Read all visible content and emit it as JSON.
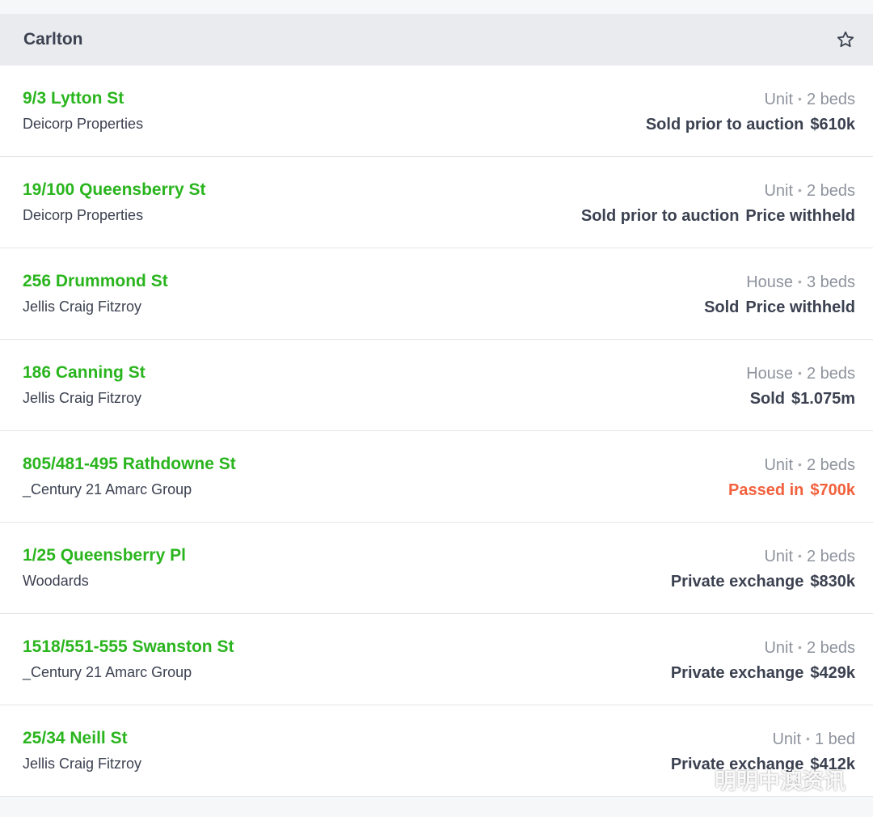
{
  "header": {
    "suburb": "Carlton",
    "favorite_icon": "star-outline-icon"
  },
  "colors": {
    "address": "#2ab51e",
    "passed_in": "#f2613d",
    "text": "#3b4150",
    "muted": "#8e939d"
  },
  "separator": "•",
  "listings": [
    {
      "address": "9/3 Lytton St",
      "agency": "Deicorp Properties",
      "type": "Unit",
      "beds": "2 beds",
      "result": "Sold prior to auction",
      "price": "$610k",
      "status": "sold"
    },
    {
      "address": "19/100 Queensberry St",
      "agency": "Deicorp Properties",
      "type": "Unit",
      "beds": "2 beds",
      "result": "Sold prior to auction",
      "price": "Price withheld",
      "status": "sold"
    },
    {
      "address": "256 Drummond St",
      "agency": "Jellis Craig Fitzroy",
      "type": "House",
      "beds": "3 beds",
      "result": "Sold",
      "price": "Price withheld",
      "status": "sold"
    },
    {
      "address": "186 Canning St",
      "agency": "Jellis Craig Fitzroy",
      "type": "House",
      "beds": "2 beds",
      "result": "Sold",
      "price": "$1.075m",
      "status": "sold"
    },
    {
      "address": "805/481-495 Rathdowne St",
      "agency": "_Century 21 Amarc Group",
      "type": "Unit",
      "beds": "2 beds",
      "result": "Passed in",
      "price": "$700k",
      "status": "passed"
    },
    {
      "address": "1/25 Queensberry Pl",
      "agency": "Woodards",
      "type": "Unit",
      "beds": "2 beds",
      "result": "Private exchange",
      "price": "$830k",
      "status": "sold"
    },
    {
      "address": "1518/551-555 Swanston St",
      "agency": "_Century 21 Amarc Group",
      "type": "Unit",
      "beds": "2 beds",
      "result": "Private exchange",
      "price": "$429k",
      "status": "sold"
    },
    {
      "address": "25/34 Neill St",
      "agency": "Jellis Craig Fitzroy",
      "type": "Unit",
      "beds": "1 bed",
      "result": "Private exchange",
      "price": "$412k",
      "status": "sold"
    }
  ],
  "watermark": {
    "text": "明明中澳资讯",
    "icon": "wechat-icon"
  }
}
